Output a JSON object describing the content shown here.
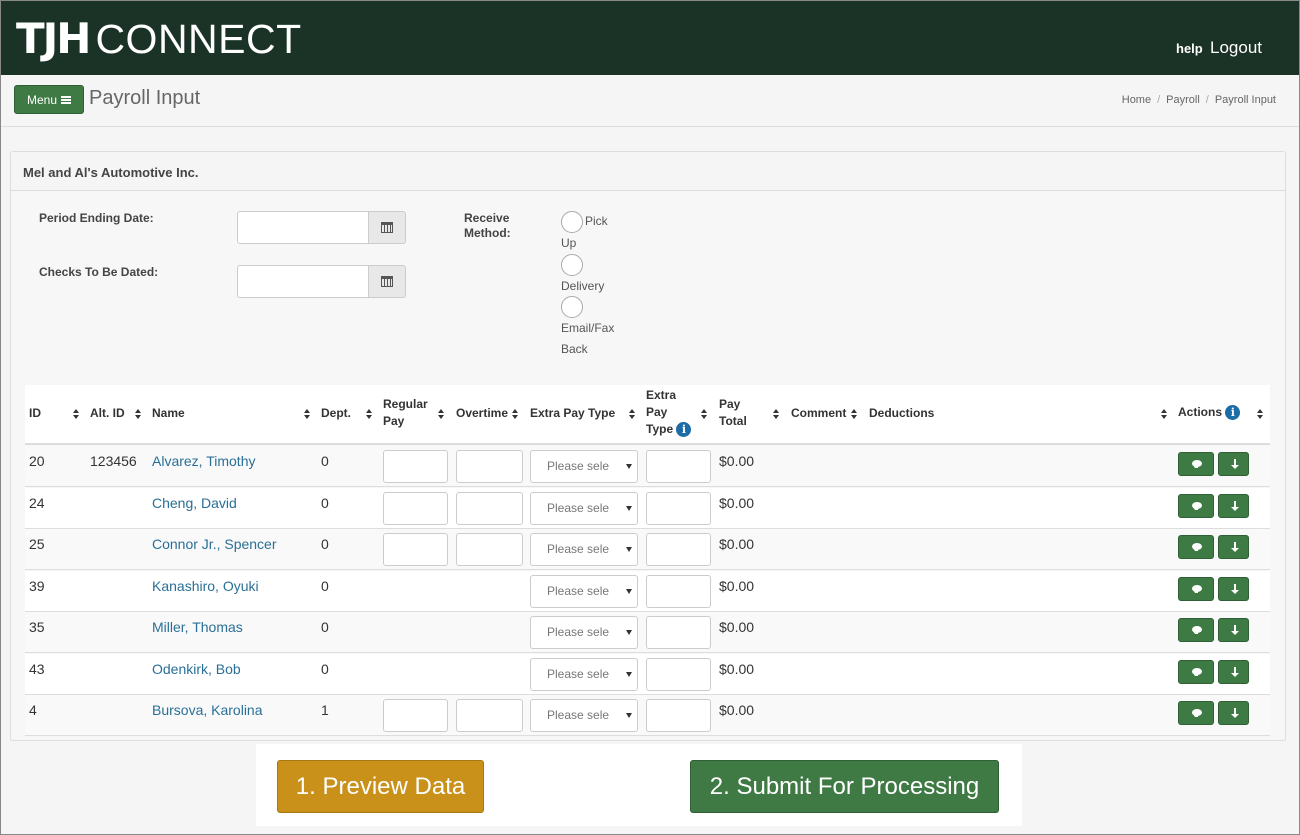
{
  "header": {
    "logo_bold": "TJH",
    "logo_light": "CONNECT",
    "help": "help",
    "logout": "Logout"
  },
  "subheader": {
    "menu_label": "Menu",
    "page_title": "Payroll Input",
    "breadcrumb": [
      "Home",
      "Payroll",
      "Payroll Input"
    ]
  },
  "panel": {
    "company": "Mel and Al's Automotive Inc.",
    "period_ending_label": "Period Ending Date:",
    "checks_dated_label": "Checks To Be Dated:",
    "receive_method_label_1": "Receive",
    "receive_method_label_2": "Method:",
    "receive_options": [
      {
        "line1": "Pick",
        "line2": "Up"
      },
      {
        "line1": "Delivery",
        "line2": ""
      },
      {
        "line1": "Email/Fax",
        "line2": "Back"
      }
    ]
  },
  "table": {
    "headers": {
      "id": "ID",
      "alt_id": "Alt. ID",
      "name": "Name",
      "dept": "Dept.",
      "regular_pay_1": "Regular",
      "regular_pay_2": "Pay",
      "overtime": "Overtime",
      "extra_pay_type": "Extra Pay Type",
      "extra_pay_type2_1": "Extra",
      "extra_pay_type2_2": "Pay",
      "extra_pay_type2_3": "Type",
      "pay_total_1": "Pay",
      "pay_total_2": "Total",
      "comment": "Comment",
      "deductions": "Deductions",
      "actions": "Actions"
    },
    "select_placeholder": "Please select",
    "rows": [
      {
        "id": "20",
        "alt_id": "123456",
        "name": "Alvarez, Timothy",
        "dept": "0",
        "pay_total": "$0.00",
        "has_pay_inputs": true
      },
      {
        "id": "24",
        "alt_id": "",
        "name": "Cheng, David",
        "dept": "0",
        "pay_total": "$0.00",
        "has_pay_inputs": true
      },
      {
        "id": "25",
        "alt_id": "",
        "name": "Connor Jr., Spencer",
        "dept": "0",
        "pay_total": "$0.00",
        "has_pay_inputs": true
      },
      {
        "id": "39",
        "alt_id": "",
        "name": "Kanashiro, Oyuki",
        "dept": "0",
        "pay_total": "$0.00",
        "has_pay_inputs": false
      },
      {
        "id": "35",
        "alt_id": "",
        "name": "Miller, Thomas",
        "dept": "0",
        "pay_total": "$0.00",
        "has_pay_inputs": false
      },
      {
        "id": "43",
        "alt_id": "",
        "name": "Odenkirk, Bob",
        "dept": "0",
        "pay_total": "$0.00",
        "has_pay_inputs": false
      },
      {
        "id": "4",
        "alt_id": "",
        "name": "Bursova, Karolina",
        "dept": "1",
        "pay_total": "$0.00",
        "has_pay_inputs": true
      }
    ]
  },
  "footer": {
    "preview": "1. Preview Data",
    "submit": "2. Submit For Processing"
  },
  "colors": {
    "header_bg": "#1b3327",
    "green_button": "#3f7a45",
    "preview_button": "#c9911a",
    "link": "#2a6f97",
    "info_icon": "#1c6ca6"
  }
}
